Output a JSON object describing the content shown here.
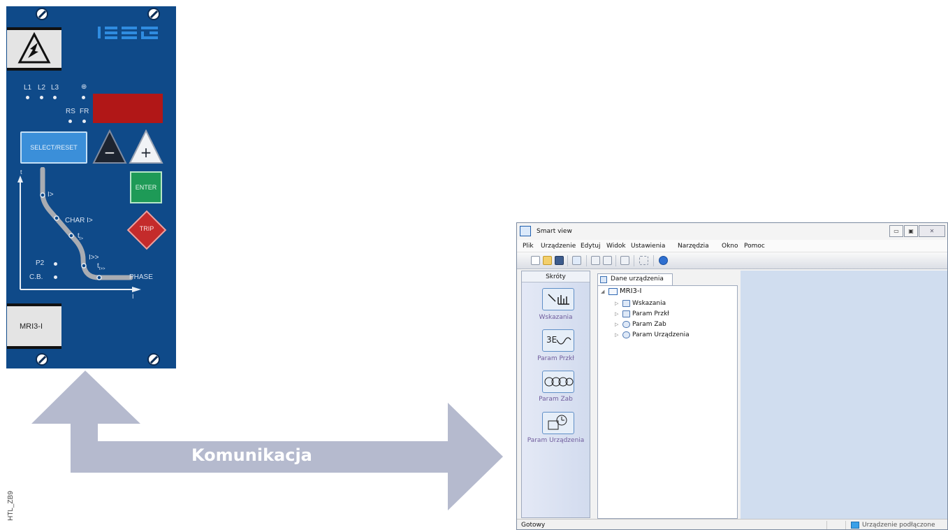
{
  "relay": {
    "brand": "ISEG",
    "led_labels": [
      "L1",
      "L2",
      "L3",
      "⊕",
      "RS",
      "FR",
      "P2",
      "C.B."
    ],
    "buttons": {
      "select_reset": "SELECT/RESET",
      "minus": "−",
      "plus": "+",
      "enter": "ENTER",
      "trip": "TRIP"
    },
    "characteristic_labels": {
      "y_axis": "t",
      "x_axis": "I",
      "i_gt": "I>",
      "char": "CHAR I>",
      "t_gt": "t",
      "t_gt_sub": "I>",
      "i_ggt": "I>>",
      "t_ggt": "t",
      "t_ggt_sub": "I>>",
      "phase": "PHASE"
    },
    "model": "MRI3-I"
  },
  "communication": {
    "label": "Komunikacja",
    "color": "#b5bace"
  },
  "figure_code": "HTL_ZB9",
  "smartview": {
    "title": "Smart view",
    "menu": [
      "Plik",
      "Urządzenie",
      "Edytuj",
      "Widok",
      "Ustawienia",
      "Narzędzia",
      "Okno",
      "Pomoc"
    ],
    "shortcuts_title": "Skróty",
    "shortcuts": [
      {
        "label": "Wskazania",
        "icon": "measurement-chart-icon"
      },
      {
        "label": "Param Przkł",
        "icon": "transformer-params-icon"
      },
      {
        "label": "Param Zab",
        "icon": "protection-params-icon"
      },
      {
        "label": "Param Urządzenia",
        "icon": "device-params-icon"
      }
    ],
    "tab": "Dane urządzenia",
    "tree": {
      "root": "MRI3-I",
      "children": [
        "Wskazania",
        "Param Przkł",
        "Param Zab",
        "Param Urządzenia"
      ]
    },
    "status": {
      "left": "Gotowy",
      "right": "Urządzenie podłączone"
    }
  }
}
